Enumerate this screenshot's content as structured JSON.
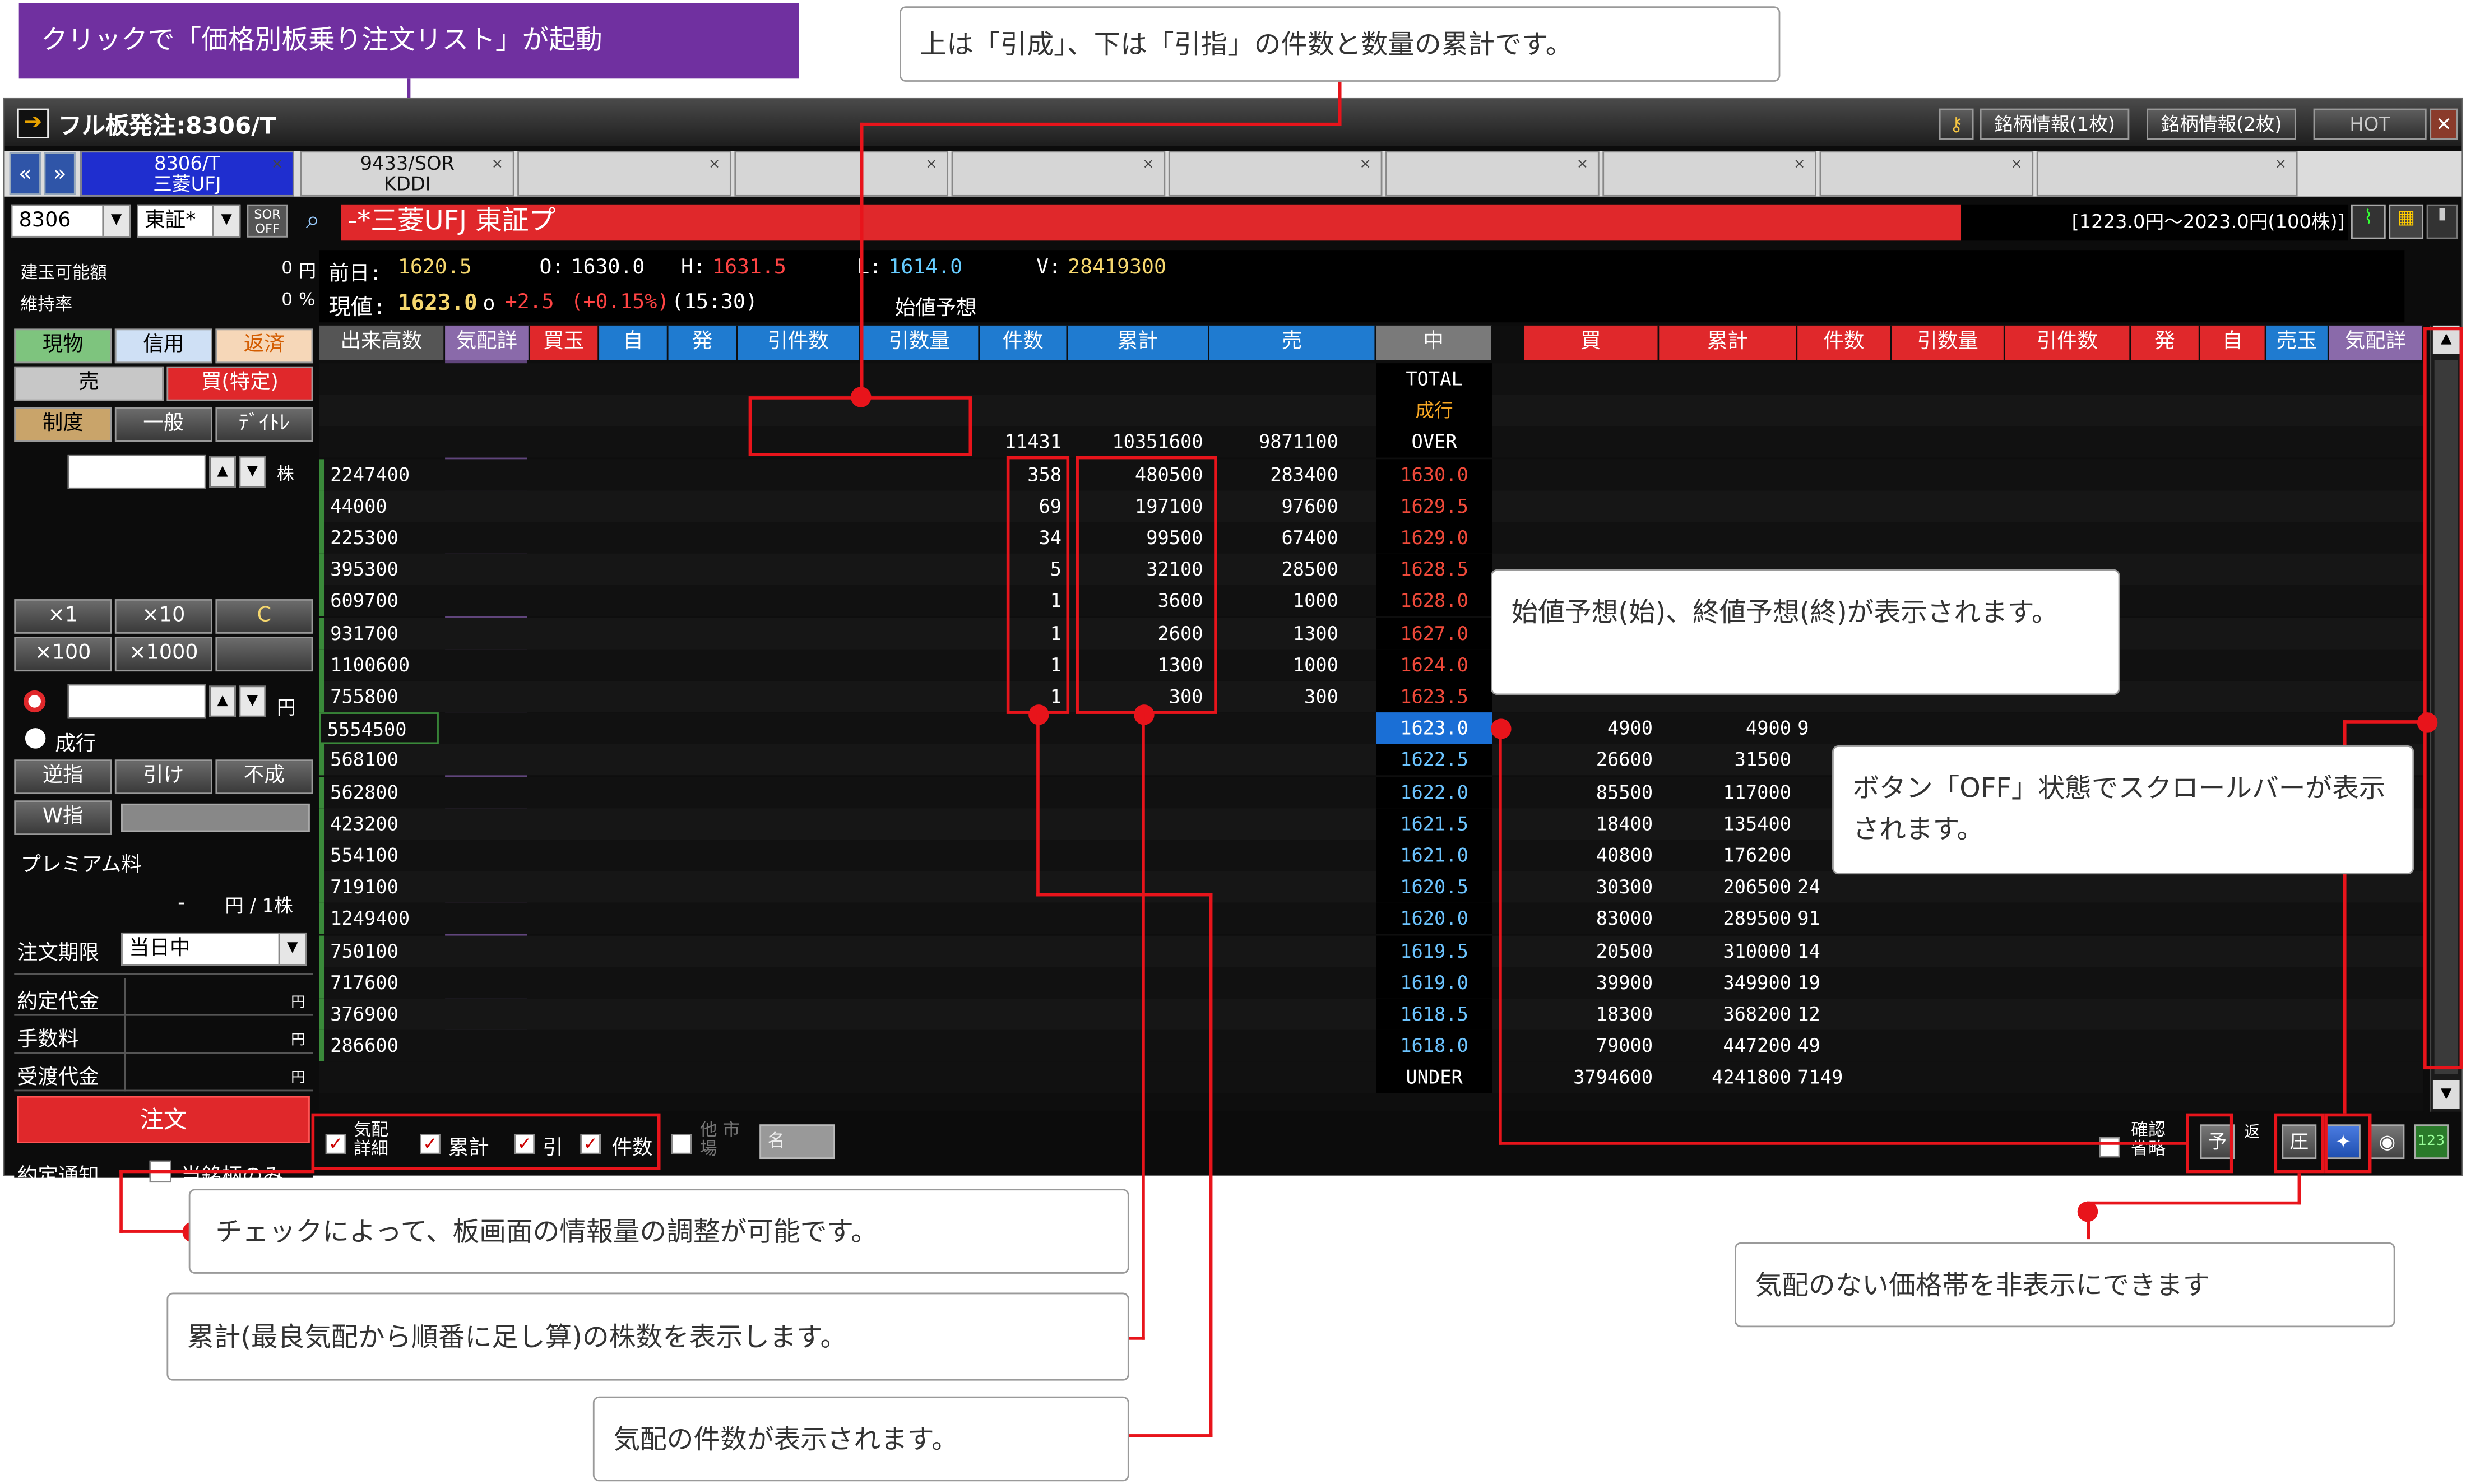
{
  "window": {
    "title": "フル板発注:8306/T",
    "title_buttons": [
      "銘柄情報(1枚)",
      "銘柄情報(2枚)",
      "HOT"
    ],
    "close_glyph": "✕"
  },
  "tabs": [
    {
      "line1": "8306/T",
      "line2": "三菱UFJ"
    },
    {
      "line1": "9433/SOR",
      "line2": "KDDI"
    },
    {
      "line1": "",
      "line2": ""
    },
    {
      "line1": "",
      "line2": ""
    },
    {
      "line1": "",
      "line2": ""
    },
    {
      "line1": "",
      "line2": ""
    },
    {
      "line1": "",
      "line2": ""
    },
    {
      "line1": "",
      "line2": ""
    },
    {
      "line1": "",
      "line2": ""
    },
    {
      "line1": "",
      "line2": ""
    }
  ],
  "symbol_bar": {
    "code": "8306",
    "market": "東証*",
    "sor": "SOR OFF",
    "name": "-*三菱UFJ 東証プ",
    "range": "[1223.0円～2023.0円(100株)]"
  },
  "account": {
    "margin_label": "建玉可能額",
    "margin_value": "0",
    "margin_unit": "円",
    "ratio_label": "維持率",
    "ratio_value": "0",
    "ratio_unit": "%"
  },
  "quote": {
    "prev_label": "前日:",
    "prev_value": "1620.5",
    "open_label": "O:",
    "open_value": "1630.0",
    "high_label": "H:",
    "high_value": "1631.5",
    "low_label": "L:",
    "low_value": "1614.0",
    "volume_label": "V:",
    "volume_value": "28419300",
    "current_label": "現値:",
    "current_value": "1623.0",
    "current_mark": "o",
    "change": "+2.5",
    "change_pct": "(+0.15%)",
    "time": "(15:30)",
    "forecast": "始値予想"
  },
  "order_panel": {
    "tab_spot": "現物",
    "tab_margin": "信用",
    "tab_repay": "返済",
    "sell": "売",
    "buy_specific": "買(特定)",
    "type_standard": "制度",
    "type_general": "一般",
    "type_daytrade": "ﾃﾞｲﾄﾚ",
    "qty_unit": "株",
    "mult_buttons": [
      "×1",
      "×10",
      "C",
      "×100",
      "×1000",
      ""
    ],
    "price_unit": "円",
    "market_order": "成行",
    "cond_buttons": [
      "逆指",
      "引け",
      "不成"
    ],
    "w_order": "W指",
    "premium_label": "プレミアム料",
    "premium_value": "-",
    "premium_unit": "円 / 1株",
    "expiry_label": "注文期限",
    "expiry_value": "当日中",
    "contract_amount": "約定代金",
    "commission": "手数料",
    "settlement_amount": "受渡代金",
    "yen": "円",
    "order_button": "注文",
    "notify_label": "約定通知",
    "this_symbol_only": "当銘柄のみ"
  },
  "board_headers": {
    "sell_side": [
      "出来高数",
      "気配詳",
      "買玉",
      "自",
      "発",
      "引件数",
      "引数量",
      "件数",
      "累計",
      "売"
    ],
    "center": "中",
    "buy_side": [
      "買",
      "累計",
      "件数",
      "引数量",
      "引件数",
      "発",
      "自",
      "売玉",
      "気配詳"
    ]
  },
  "board_top": [
    {
      "center": "TOTAL"
    },
    {
      "center": "成行"
    },
    {
      "center": "OVER",
      "count": "11431",
      "cum": "10351600",
      "qty": "9871100"
    }
  ],
  "ask_rows": [
    {
      "vol": "2247400",
      "count": "358",
      "cum": "480500",
      "qty": "283400",
      "price": "1630.0"
    },
    {
      "vol": "44000",
      "count": "69",
      "cum": "197100",
      "qty": "97600",
      "price": "1629.5"
    },
    {
      "vol": "225300",
      "count": "34",
      "cum": "99500",
      "qty": "67400",
      "price": "1629.0"
    },
    {
      "vol": "395300",
      "count": "5",
      "cum": "32100",
      "qty": "28500",
      "price": "1628.5"
    },
    {
      "vol": "609700",
      "count": "1",
      "cum": "3600",
      "qty": "1000",
      "price": "1628.0"
    },
    {
      "vol": "931700",
      "count": "1",
      "cum": "2600",
      "qty": "1300",
      "price": "1627.0"
    },
    {
      "vol": "1100600",
      "count": "1",
      "cum": "1300",
      "qty": "1000",
      "price": "1624.0"
    },
    {
      "vol": "755800",
      "count": "1",
      "cum": "300",
      "qty": "300",
      "price": "1623.5"
    }
  ],
  "current_row": {
    "vol": "5554500",
    "price": "1623.0",
    "qty": "4900",
    "cum": "4900",
    "count": "9"
  },
  "bid_rows": [
    {
      "vol": "568100",
      "price": "1622.5",
      "qty": "26600",
      "cum": "31500",
      "count": ""
    },
    {
      "vol": "562800",
      "price": "1622.0",
      "qty": "85500",
      "cum": "117000",
      "count": ""
    },
    {
      "vol": "423200",
      "price": "1621.5",
      "qty": "18400",
      "cum": "135400",
      "count": ""
    },
    {
      "vol": "554100",
      "price": "1621.0",
      "qty": "40800",
      "cum": "176200",
      "count": ""
    },
    {
      "vol": "719100",
      "price": "1620.5",
      "qty": "30300",
      "cum": "206500",
      "count": "24"
    },
    {
      "vol": "1249400",
      "price": "1620.0",
      "qty": "83000",
      "cum": "289500",
      "count": "91"
    },
    {
      "vol": "750100",
      "price": "1619.5",
      "qty": "20500",
      "cum": "310000",
      "count": "14"
    },
    {
      "vol": "717600",
      "price": "1619.0",
      "qty": "39900",
      "cum": "349900",
      "count": "19"
    },
    {
      "vol": "376900",
      "price": "1618.5",
      "qty": "18300",
      "cum": "368200",
      "count": "12"
    },
    {
      "vol": "286600",
      "price": "1618.0",
      "qty": "79000",
      "cum": "447200",
      "count": "49"
    }
  ],
  "under_row": {
    "label": "UNDER",
    "qty": "3794600",
    "cum": "4241800",
    "count": "7149"
  },
  "bottom_bar": {
    "detail": "気配 詳細",
    "cumulative": "累計",
    "close": "引",
    "count": "件数",
    "other_market": "他 市場",
    "name": "名",
    "confirm_omit": "確認 省略",
    "forecast_btn": "予",
    "repay": "返",
    "compress": "圧"
  },
  "callouts": {
    "purple": "クリックで「価格別板乗り注文リスト」が起動",
    "top": "上は「引成」、下は「引指」の件数と数量の累計です。",
    "forecast": "始値予想(始)、終値予想(終)が表示されます。",
    "scroll": "ボタン「OFF」状態でスクロールバーが表示されます。",
    "checks": "チェックによって、板画面の情報量の調整が可能です。",
    "cumulative": "累計(最良気配から順番に足し算)の株数を表示します。",
    "count": "気配の件数が表示されます。",
    "hide": "気配のない価格帯を非表示にできます"
  },
  "colors": {
    "sell_header": "#1f7bd0",
    "buy_header": "#e0282b",
    "purple": "#7030a0",
    "annotation_red": "#e8141b",
    "highlight_price": "#1a6fd6"
  }
}
